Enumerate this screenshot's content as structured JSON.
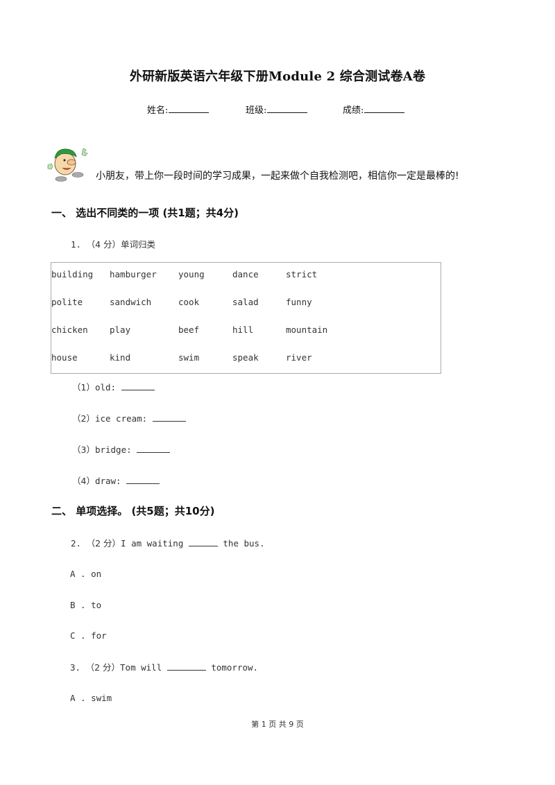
{
  "header": {
    "title": "外研新版英语六年级下册Module 2 综合测试卷A卷",
    "fields": [
      {
        "label": "姓名:"
      },
      {
        "label": "班级:"
      },
      {
        "label": "成绩:"
      }
    ]
  },
  "intro": "小朋友，带上你一段时间的学习成果，一起来做个自我检测吧，相信你一定是最棒的!",
  "section1": {
    "heading": "一、  选出不同类的一项 (共1题；共4分)",
    "q1": {
      "number": "1.",
      "score": "（4 分）",
      "prompt": "单词归类",
      "words": [
        [
          "building",
          "hamburger",
          "young",
          "dance",
          "strict"
        ],
        [
          "polite",
          "sandwich",
          "cook",
          "salad",
          "funny"
        ],
        [
          "chicken",
          "play",
          "beef",
          "hill",
          "mountain"
        ],
        [
          "house",
          "kind",
          "swim",
          "speak",
          "river"
        ]
      ],
      "subs": [
        {
          "num": "（1）",
          "word": "old:"
        },
        {
          "num": "（2）",
          "word": "ice cream:"
        },
        {
          "num": "（3）",
          "word": "bridge:"
        },
        {
          "num": "（4）",
          "word": "draw:"
        }
      ]
    }
  },
  "section2": {
    "heading": "二、  单项选择。 (共5题；共10分)",
    "q2": {
      "number": "2.",
      "score": "（2 分）",
      "before": "I am waiting",
      "after": "the bus.",
      "options": [
        {
          "letter": "A .",
          "text": "on"
        },
        {
          "letter": "B .",
          "text": "to"
        },
        {
          "letter": "C .",
          "text": "for"
        }
      ]
    },
    "q3": {
      "number": "3.",
      "score": "（2 分）",
      "before": "Tom will",
      "after": "tomorrow.",
      "options": [
        {
          "letter": "A .",
          "text": "swim"
        }
      ]
    }
  },
  "footer": "第 1 页 共 9 页"
}
